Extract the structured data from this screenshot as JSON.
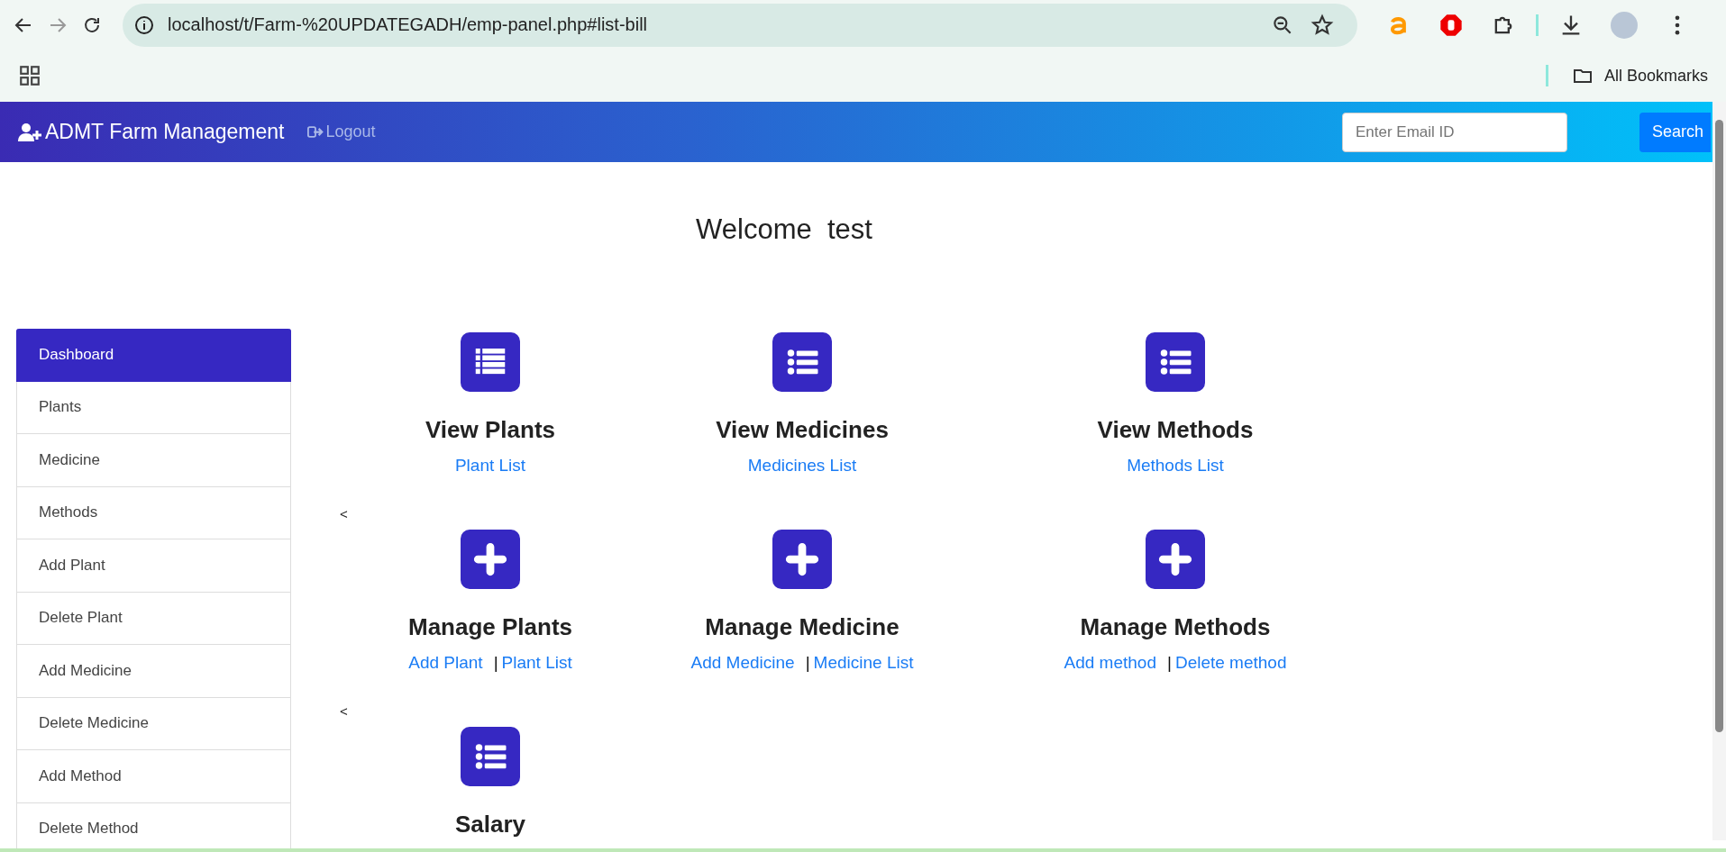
{
  "browser": {
    "url": "localhost/t/Farm-%20UPDATEGADH/emp-panel.php#list-bill",
    "bookmarks_label": "All Bookmarks"
  },
  "navbar": {
    "brand": "ADMT Farm Management",
    "logout": "Logout",
    "search_placeholder": "Enter Email ID",
    "search_button": "Search"
  },
  "welcome": "Welcome  test",
  "sidebar": {
    "items": [
      {
        "label": "Dashboard",
        "selected": true
      },
      {
        "label": "Plants",
        "selected": false
      },
      {
        "label": "Medicine",
        "selected": false
      },
      {
        "label": "Methods",
        "selected": false
      },
      {
        "label": "Add Plant",
        "selected": false
      },
      {
        "label": "Delete Plant",
        "selected": false
      },
      {
        "label": "Add Medicine",
        "selected": false
      },
      {
        "label": "Delete Medicine",
        "selected": false
      },
      {
        "label": "Add Method",
        "selected": false
      },
      {
        "label": "Delete Method",
        "selected": false
      }
    ]
  },
  "rows": [
    {
      "marker": null,
      "cards": [
        {
          "kind": "table",
          "title": "View Plants",
          "links": [
            "Plant List"
          ]
        },
        {
          "kind": "list",
          "title": "View Medicines",
          "links": [
            "Medicines List"
          ]
        },
        {
          "kind": "list",
          "title": "View Methods",
          "links": [
            "Methods List"
          ]
        }
      ]
    },
    {
      "marker": "<",
      "cards": [
        {
          "kind": "add",
          "title": "Manage Plants",
          "links": [
            "Add Plant",
            "Plant List"
          ],
          "separator": "|"
        },
        {
          "kind": "add",
          "title": "Manage Medicine",
          "links": [
            "Add Medicine",
            "Medicine List"
          ],
          "separator": "|"
        },
        {
          "kind": "add",
          "title": "Manage Methods",
          "links": [
            "Add method",
            "Delete method"
          ],
          "separator": "|"
        }
      ]
    },
    {
      "marker": "<",
      "cards": [
        {
          "kind": "list",
          "title": "Salary"
        }
      ]
    }
  ]
}
